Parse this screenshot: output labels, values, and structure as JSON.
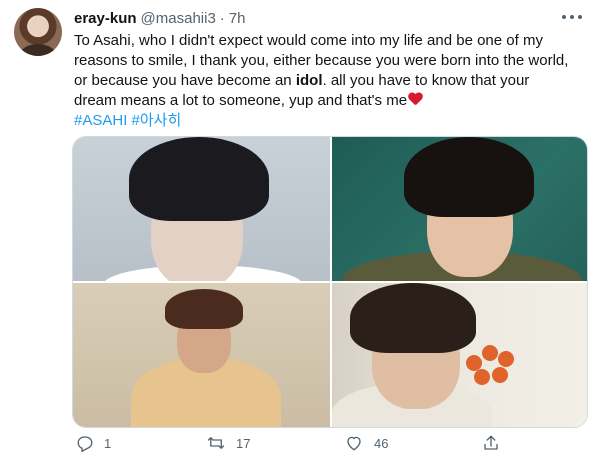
{
  "tweet": {
    "display_name": "eray-kun",
    "handle": "@masahii3",
    "separator": "·",
    "time": "7h",
    "text_lines": [
      "To Asahi, who I didn't expect would come into my life and be one of my",
      "reasons to smile, I thank you, either because you were born into the world,",
      "or because you have become an ",
      "dream means a lot to someone, yup and that's me"
    ],
    "bold_word": "idol",
    "line3_rest": ". all you have to know that your",
    "hashtags": "#ASAHI #아사히"
  },
  "stats": {
    "replies": "1",
    "retweets": "17",
    "likes": "46"
  },
  "icons": {
    "more": "more-horizontal-icon",
    "reply": "reply-icon",
    "retweet": "retweet-icon",
    "like": "like-icon",
    "share": "share-icon",
    "emoji": "red-heart-emoji"
  },
  "colors": {
    "link": "#1d9bf0",
    "secondary_text": "#536471",
    "heart_emoji": "#d81b2c"
  }
}
